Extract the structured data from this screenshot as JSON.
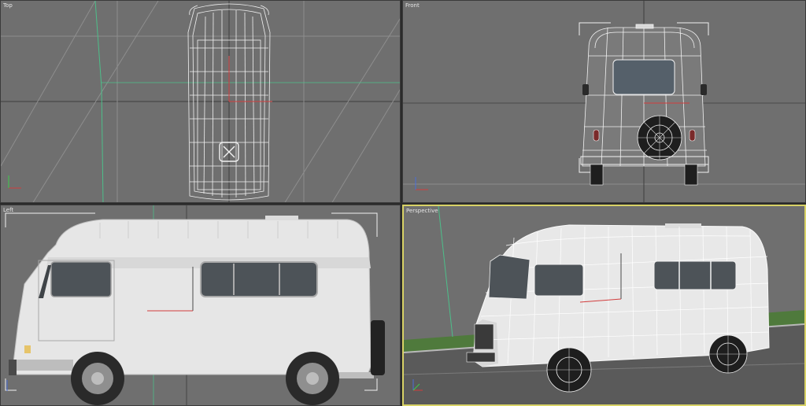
{
  "viewports": {
    "top": {
      "label": "Top"
    },
    "front": {
      "label": "Front"
    },
    "left": {
      "label": "Left"
    },
    "perspective": {
      "label": "Perspective"
    }
  },
  "colors": {
    "viewport_bg": "#6f6f6f",
    "active_border": "#d8d266",
    "wire": "#f2f2f2",
    "grid": "#9a9a9a",
    "axis_x": "#d23c3c",
    "axis_y": "#3ccb4a",
    "axis_z": "#4a6ed8",
    "grid_green_line": "#4dbf8a",
    "body_shaded": "#e8e8e8"
  },
  "axis_tripod": {
    "x": "x",
    "y": "y",
    "z": "z"
  }
}
